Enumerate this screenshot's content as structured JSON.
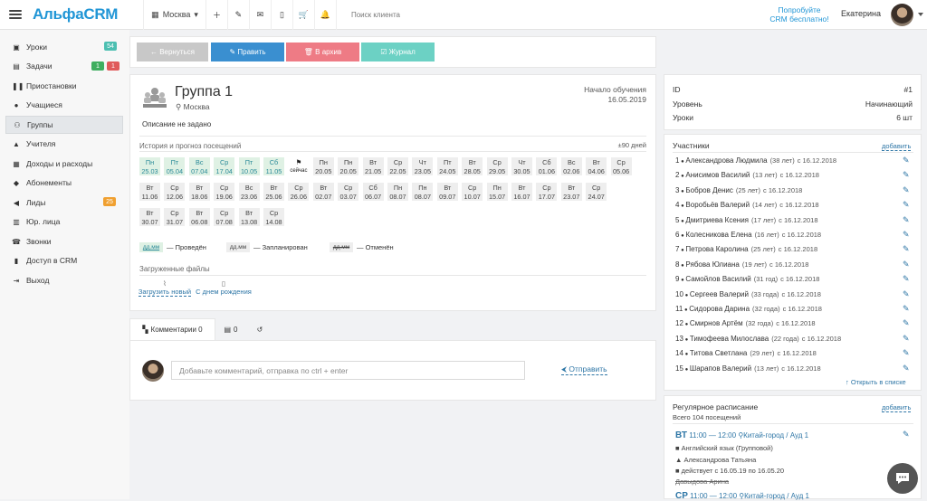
{
  "header": {
    "logo": "АльфаCRM",
    "city": "Москва",
    "search_placeholder": "Поиск клиента",
    "try_line1": "Попробуйте",
    "try_line2": "CRM бесплатно!",
    "user_name": "Екатерина",
    "icons": [
      "plus-icon",
      "wrench-icon",
      "envelope-icon",
      "mobile-icon",
      "cart-icon",
      "bell-icon"
    ]
  },
  "sidebar": {
    "items": [
      {
        "label": "Уроки",
        "icon": "calendar-icon"
      },
      {
        "label": "Задачи",
        "icon": "tasks-icon"
      },
      {
        "label": "Приостановки",
        "icon": "pause-icon"
      },
      {
        "label": "Учащиеся",
        "icon": "user-icon"
      },
      {
        "label": "Группы",
        "icon": "users-icon"
      },
      {
        "label": "Учителя",
        "icon": "graduation-cap-icon"
      },
      {
        "label": "Доходы и расходы",
        "icon": "money-icon"
      },
      {
        "label": "Абонементы",
        "icon": "tag-icon"
      },
      {
        "label": "Лиды",
        "icon": "bullhorn-icon"
      },
      {
        "label": "Юр. лица",
        "icon": "building-icon"
      },
      {
        "label": "Звонки",
        "icon": "phone-icon"
      },
      {
        "label": "Доступ в CRM",
        "icon": "lock-icon"
      },
      {
        "label": "Выход",
        "icon": "sign-out-icon"
      }
    ],
    "badges": {
      "lessons": "54",
      "tasks_green": "1",
      "tasks_red": "1",
      "leads": "25"
    }
  },
  "actions": {
    "back": "← Вернуться",
    "edit": "✎ Править",
    "archive": "🗑 В архив",
    "journal": "☑ Журнал"
  },
  "group": {
    "title": "Группа 1",
    "location": "Москва",
    "start_label": "Начало обучения",
    "start_date": "16.05.2019",
    "description": "Описание не задано",
    "history_label": "История и прогноз посещений",
    "history_range": "±90 дней"
  },
  "attendance": [
    {
      "d": "Пн",
      "t": "25.03",
      "s": "done"
    },
    {
      "d": "Пт",
      "t": "05.04",
      "s": "done"
    },
    {
      "d": "Вс",
      "t": "07.04",
      "s": "done"
    },
    {
      "d": "Ср",
      "t": "17.04",
      "s": "done"
    },
    {
      "d": "Пт",
      "t": "10.05",
      "s": "done"
    },
    {
      "d": "Сб",
      "t": "11.05",
      "s": "done"
    },
    {
      "d": "⚑",
      "t": "сейчас",
      "s": "today"
    },
    {
      "d": "Пн",
      "t": "20.05",
      "s": "plan"
    },
    {
      "d": "Пн",
      "t": "20.05",
      "s": "plan"
    },
    {
      "d": "Вт",
      "t": "21.05",
      "s": "plan"
    },
    {
      "d": "Ср",
      "t": "22.05",
      "s": "plan"
    },
    {
      "d": "Чт",
      "t": "23.05",
      "s": "plan"
    },
    {
      "d": "Пт",
      "t": "24.05",
      "s": "plan"
    },
    {
      "d": "Вт",
      "t": "28.05",
      "s": "plan"
    },
    {
      "d": "Ср",
      "t": "29.05",
      "s": "plan"
    },
    {
      "d": "Чт",
      "t": "30.05",
      "s": "plan"
    },
    {
      "d": "Сб",
      "t": "01.06",
      "s": "plan"
    },
    {
      "d": "Вс",
      "t": "02.06",
      "s": "plan"
    },
    {
      "d": "Вт",
      "t": "04.06",
      "s": "plan"
    },
    {
      "d": "Ср",
      "t": "05.06",
      "s": "plan"
    },
    {
      "d": "Вт",
      "t": "11.06",
      "s": "plan"
    },
    {
      "d": "Ср",
      "t": "12.06",
      "s": "plan"
    },
    {
      "d": "Вт",
      "t": "18.06",
      "s": "plan"
    },
    {
      "d": "Ср",
      "t": "19.06",
      "s": "plan"
    },
    {
      "d": "Вс",
      "t": "23.06",
      "s": "plan"
    },
    {
      "d": "Вт",
      "t": "25.06",
      "s": "plan"
    },
    {
      "d": "Ср",
      "t": "26.06",
      "s": "plan"
    },
    {
      "d": "Вт",
      "t": "02.07",
      "s": "plan"
    },
    {
      "d": "Ср",
      "t": "03.07",
      "s": "plan"
    },
    {
      "d": "Сб",
      "t": "06.07",
      "s": "plan"
    },
    {
      "d": "Пн",
      "t": "08.07",
      "s": "plan"
    },
    {
      "d": "Пн",
      "t": "08.07",
      "s": "plan"
    },
    {
      "d": "Вт",
      "t": "09.07",
      "s": "plan"
    },
    {
      "d": "Ср",
      "t": "10.07",
      "s": "plan"
    },
    {
      "d": "Пн",
      "t": "15.07",
      "s": "plan"
    },
    {
      "d": "Вт",
      "t": "16.07",
      "s": "plan"
    },
    {
      "d": "Ср",
      "t": "17.07",
      "s": "plan"
    },
    {
      "d": "Вт",
      "t": "23.07",
      "s": "plan"
    },
    {
      "d": "Ср",
      "t": "24.07",
      "s": "plan"
    },
    {
      "d": "Вт",
      "t": "30.07",
      "s": "plan"
    },
    {
      "d": "Ср",
      "t": "31.07",
      "s": "plan"
    },
    {
      "d": "Вт",
      "t": "06.08",
      "s": "plan"
    },
    {
      "d": "Ср",
      "t": "07.08",
      "s": "plan"
    },
    {
      "d": "Вт",
      "t": "13.08",
      "s": "plan"
    },
    {
      "d": "Ср",
      "t": "14.08",
      "s": "plan"
    }
  ],
  "legend": {
    "sample": "дд.мм",
    "done": "— Проведён",
    "planned": "— Запланирован",
    "cancelled": "— Отменён"
  },
  "files": {
    "label": "Загруженные файлы",
    "upload": "Загрузить новый",
    "file1": "С днем рождения"
  },
  "tabs": {
    "comments": "Комментарии 0",
    "notes": "0"
  },
  "comment": {
    "placeholder": "Добавьте комментарий, отправка по ctrl + enter",
    "send": "⮜ Отправить"
  },
  "info": {
    "id_label": "ID",
    "id_value": "#1",
    "level_label": "Уровень",
    "level_value": "Начинающий",
    "lessons_label": "Уроки",
    "lessons_value": "6 шт"
  },
  "members_title": "Участники",
  "members_add": "добавить",
  "members": [
    {
      "n": "1",
      "name": "Александрова Людмила",
      "age": "(38 лет)",
      "since": "с 16.12.2018"
    },
    {
      "n": "2",
      "name": "Анисимов Василий",
      "age": "(13 лет)",
      "since": "с 16.12.2018"
    },
    {
      "n": "3",
      "name": "Бобров Денис",
      "age": "(25 лет)",
      "since": "с 16.12.2018"
    },
    {
      "n": "4",
      "name": "Воробьёв Валерий",
      "age": "(14 лет)",
      "since": "с 16.12.2018"
    },
    {
      "n": "5",
      "name": "Дмитриева Ксения",
      "age": "(17 лет)",
      "since": "с 16.12.2018"
    },
    {
      "n": "6",
      "name": "Колесникова Елена",
      "age": "(16 лет)",
      "since": "с 16.12.2018"
    },
    {
      "n": "7",
      "name": "Петрова Каролина",
      "age": "(25 лет)",
      "since": "с 16.12.2018"
    },
    {
      "n": "8",
      "name": "Рябова Юлиана",
      "age": "(19 лет)",
      "since": "с 16.12.2018"
    },
    {
      "n": "9",
      "name": "Самойлов Василий",
      "age": "(31 год)",
      "since": "с 16.12.2018"
    },
    {
      "n": "10",
      "name": "Сергеев Валерий",
      "age": "(33 года)",
      "since": "с 16.12.2018"
    },
    {
      "n": "11",
      "name": "Сидорова Дарина",
      "age": "(32 года)",
      "since": "с 16.12.2018"
    },
    {
      "n": "12",
      "name": "Смирнов Артём",
      "age": "(32 года)",
      "since": "с 16.12.2018"
    },
    {
      "n": "13",
      "name": "Тимофеева Милослава",
      "age": "(22 года)",
      "since": "с 16.12.2018"
    },
    {
      "n": "14",
      "name": "Титова Светлана",
      "age": "(29 лет)",
      "since": "с 16.12.2018"
    },
    {
      "n": "15",
      "name": "Шарапов Валерий",
      "age": "(13 лет)",
      "since": "с 16.12.2018"
    }
  ],
  "open_in_list": "↑ Открыть в списке",
  "schedule": {
    "title": "Регулярное расписание",
    "add": "добавить",
    "total": "Всего 104 посещений",
    "day": "ВТ",
    "time": "11:00 — 12:00",
    "room": "Китай-город / Ауд 1",
    "subject": "Английский язык (Групповой)",
    "teacher": "Александрова Татьяна",
    "period": "действует с 16.05.19 по 16.05.20",
    "extra": "Давыдова Арина",
    "next_day": "СР",
    "next_time": "11:00 — 12:00",
    "next_room": "Китай-город / Ауд 1"
  }
}
